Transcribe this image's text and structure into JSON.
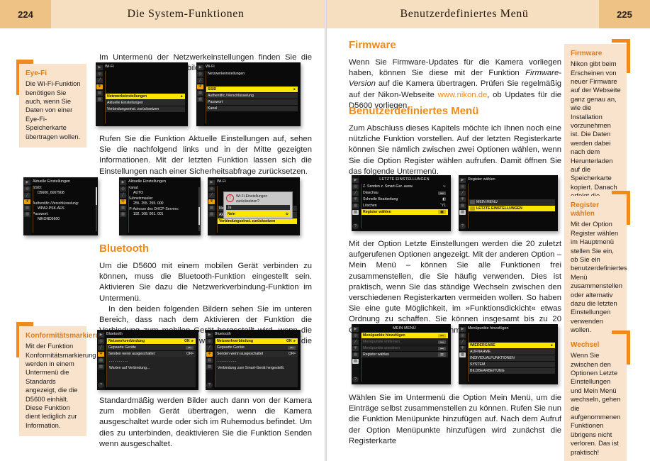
{
  "pages": {
    "left": {
      "number": "224",
      "running_head": "Die System-Funktionen",
      "paragraphs": {
        "intro": "Im Untermenü der Netzwerkeinstellungen finden Sie die nachfolgend rechts abgebildeten Funktionen vor.",
        "after_wifi": "Rufen Sie die Funktion Aktuelle Einstellungen auf, sehen Sie die nachfolgend links und in der Mitte gezeigten Informationen. Mit der letzten Funktion lassen sich die Einstellungen nach einer Sicherheitsabfrage zurücksetzen.",
        "bluetooth_heading": "Bluetooth",
        "bt_p1": "Um die D5600 mit einem mobilen Gerät verbinden zu können, muss die Bluetooth-Funktion eingestellt sein. Aktivieren Sie dazu die Netzwerkverbindung-Funktion im Untermenü.",
        "bt_p2": "In den beiden folgenden Bildern sehen Sie im unteren Bereich, dass nach dem Aktivieren der Funktion die Verbindung zum mobilen Gerät hergestellt wird, wenn die SnapBridge-App gestartet wurde. Rechts sehen Sie die erfolgreiche Verbindung.",
        "bt_p3": "Standardmäßig werden Bilder auch dann von der Kamera zum mobilen Gerät übertragen, wenn die Kamera ausgeschaltet wurde oder sich im Ruhemodus befindet. Um dies zu unterbinden, deaktivieren Sie die Funktion Senden wenn ausgeschaltet."
      },
      "notes": [
        {
          "title": "Eye-Fi",
          "text": "Die Wi-Fi-Funktion benötigen Sie auch, wenn Sie Daten von einer Eye-Fi-Speicherkarte übertragen wollen."
        },
        {
          "title": "Konformitätsmarkierung",
          "text": "Mit der Funktion Konformitätsmarkierung werden in einem Untermenü die Standards angezeigt, die die D5600 einhält. Diese Funktion dient lediglich zur Information."
        }
      ],
      "screens": {
        "wifi1": {
          "title": "Wi-Fi",
          "rows": [
            {
              "label": "Netzwerkeinstellungen",
              "value": "",
              "state": "selected",
              "arrow": "▸"
            },
            {
              "label": "Aktuelle Einstellungen",
              "value": "",
              "state": "normal",
              "arrow": ""
            },
            {
              "label": "Verbindungseinst. zurücksetzen",
              "value": "",
              "state": "normal",
              "arrow": ""
            }
          ]
        },
        "wifi2": {
          "title": "Wi-Fi",
          "header_row": "Netzwerkeinstellungen",
          "rows": [
            {
              "label": "SSID",
              "value": "",
              "state": "selected",
              "arrow": "▸"
            },
            {
              "label": "Authentific./Verschlüsselung",
              "value": "",
              "state": "normal",
              "arrow": ""
            },
            {
              "label": "Passwort",
              "value": "",
              "state": "normal",
              "arrow": ""
            },
            {
              "label": "Kanal",
              "value": "",
              "state": "normal",
              "arrow": ""
            }
          ]
        },
        "current1": {
          "title": "Aktuelle Einstellungen",
          "lines": [
            {
              "label": "SSID:",
              "value": "D5600_6007908"
            },
            {
              "label": "",
              "value": ""
            },
            {
              "label": "Authentific./Verschlüsselung:",
              "value": "WPA2-PSK-AES"
            },
            {
              "label": "Passwort:",
              "value": "NIKOND5600"
            }
          ]
        },
        "current2": {
          "title": "Aktuelle Einstellungen",
          "lines": [
            {
              "label": "Kanal:",
              "value": "AUTO"
            },
            {
              "label": "Subnetzmaske:",
              "value": "255. 255. 255. 000"
            },
            {
              "label": "IP-Adresse des DHCP-Servers:",
              "value": "192. 168. 001. 001"
            }
          ]
        },
        "reset": {
          "title": "Wi-Fi",
          "background_rows": [
            "Netzwerkeinstellungen",
            "Aktuelle Einstellungen",
            "Verbindungseinst. zurücksetzen"
          ],
          "dialog": {
            "message": "Wi-Fi-Einstellungen zurücksetzen?",
            "options": [
              {
                "label": "Ja",
                "state": "normal",
                "badge": ""
              },
              {
                "label": "Nein",
                "state": "selected",
                "badge": "⊙"
              }
            ]
          }
        },
        "bt1": {
          "title": "Bluetooth",
          "rows": [
            {
              "label": "Netzwerkverbindung",
              "value": "ON",
              "state": "selected",
              "arrow": "▸"
            },
            {
              "label": "Gepaarte Geräte",
              "value": "•••",
              "state": "normal",
              "arrow": ""
            },
            {
              "label": "Senden wenn ausgeschaltet",
              "value": "OFF",
              "state": "normal",
              "arrow": ""
            }
          ],
          "status_dashes": "----------",
          "status": "Warten auf Verbindung..."
        },
        "bt2": {
          "title": "Bluetooth",
          "rows": [
            {
              "label": "Netzwerkverbindung",
              "value": "ON",
              "state": "selected",
              "arrow": "▸"
            },
            {
              "label": "Gepaarte Geräte",
              "value": "•••",
              "state": "normal",
              "arrow": ""
            },
            {
              "label": "Senden wenn ausgeschaltet",
              "value": "OFF",
              "state": "normal",
              "arrow": ""
            }
          ],
          "status_dashes": "----------",
          "status": "Verbindung zum Smart-Gerät hergestellt."
        }
      }
    },
    "right": {
      "number": "225",
      "running_head": "Benutzerdefiniertes Menü",
      "paragraphs": {
        "firmware_heading": "Firmware",
        "fw_p1a": "Wenn Sie Firmware-Updates für die Kamera vorliegen haben, können Sie diese mit der Funktion ",
        "fw_p1_it": "Firmware-Version",
        "fw_p1b": " auf die Kamera übertragen. Prüfen Sie regelmäßig auf der Nikon-Webseite ",
        "fw_url": "www.nikon.de",
        "fw_p1c": ", ob Updates für die D5600 vorliegen.",
        "custom_heading": "Benutzerdefiniertes Menü",
        "cm_p1": "Zum Abschluss dieses Kapitels möchte ich Ihnen noch eine nützliche Funktion vorstellen. Auf der letzten Registerkarte können Sie nämlich zwischen zwei Optionen wählen, wenn Sie die Option Register wählen aufrufen. Damit öffnen Sie das folgende Untermenü.",
        "cm_p2": "Mit der Option Letzte Einstellungen werden die 20 zuletzt aufgerufenen Optionen angezeigt. Mit der anderen Option – Mein Menü – können Sie alle Funktionen frei zusammenstellen, die Sie häufig verwenden. Dies ist praktisch, wenn Sie das ständige Wechseln zwischen den verschiedenen Registerkarten vermeiden wollen. So haben Sie eine gute Möglichkeit, im »Funktionsdickicht« etwas Ordnung zu schaffen. Sie können insgesamt bis zu 20 Optionen in das Menü aufnehmen.",
        "cm_p3": "Wählen Sie im Untermenü die Option Mein Menü, um die Einträge selbst zusammenstellen zu können. Rufen Sie nun die Funktion Menüpunkte hinzufügen auf. Nach dem Aufruf der Option Menüpunkte hinzufügen wird zunächst die Registerkarte"
      },
      "notes": [
        {
          "title": "Firmware",
          "text": "Nikon gibt beim Erscheinen von neuer Firmware auf der Webseite ganz genau an, wie die Installation vorzunehmen ist. Die Daten werden dabei nach dem Herunterladen auf die Speicherkarte kopiert. Danach erfolgt die Installation."
        },
        {
          "title": "Register wählen",
          "text": "Mit der Option Register wählen im Hauptmenü stellen Sie ein, ob Sie ein benutzerdefiniertes Menü zusammenstellen oder alternativ dazu die letzten Einstellungen verwenden wollen."
        },
        {
          "title": "Wechsel",
          "text": "Wenn Sie zwischen den Optionen Letzte Einstellungen und Mein Menü wechseln, gehen die aufgenommenen Funktionen übrigens nicht verloren. Das ist praktisch!"
        }
      ],
      "screens": {
        "recent": {
          "title": "LETZTE EINSTELLUNGEN",
          "rows": [
            {
              "label": "Z. Senden z. Smart-Ger. ausw.",
              "value": "∿",
              "state": "normal"
            },
            {
              "label": "Diaschau",
              "value": "•••",
              "state": "normal"
            },
            {
              "label": "Schnelle Bearbeitung",
              "value": "◧",
              "state": "normal"
            },
            {
              "label": "Löschen",
              "value": "Ὕ1",
              "state": "normal"
            },
            {
              "label": "Register wählen",
              "value": "▤",
              "state": "selected"
            }
          ]
        },
        "tab_select": {
          "title": "Register wählen",
          "rows": [
            {
              "label": "MEIN MENÜ",
              "state": "normal"
            },
            {
              "label": "LETZTE EINSTELLUNGEN",
              "state": "selected"
            }
          ]
        },
        "my_menu": {
          "title": "MEIN MENÜ",
          "rows": [
            {
              "label": "Menüpunkte hinzufügen",
              "value": "•••",
              "state": "selected"
            },
            {
              "label": "Menüpunkte entfernen",
              "value": "•••",
              "state": "dim"
            },
            {
              "label": "Menüpunkte anordnen",
              "value": "•••",
              "state": "dim"
            },
            {
              "label": "Register wählen",
              "value": "▤",
              "state": "normal"
            }
          ]
        },
        "add_items": {
          "title": "Menüpunkte hinzufügen",
          "rows": [
            {
              "label": "WIEDERGABE",
              "state": "selected",
              "arrow": "▸"
            },
            {
              "label": "AUFNAHME",
              "state": "normal",
              "arrow": ""
            },
            {
              "label": "INDIVIDUALFUNKTIONEN",
              "state": "normal",
              "arrow": ""
            },
            {
              "label": "SYSTEM",
              "state": "normal",
              "arrow": ""
            },
            {
              "label": "BILDBEARBEITUNG",
              "state": "normal",
              "arrow": ""
            }
          ]
        }
      }
    }
  },
  "colors": {
    "accent": "#ef8a1b",
    "header_band": "#f6dfc0",
    "header_number": "#eec184",
    "note_bg": "#fae3cc",
    "lcd_highlight": "#ffe600"
  },
  "rail_icons": [
    "▶",
    "◯",
    "╱",
    "Ψ",
    "▤",
    "Ὕ1"
  ]
}
